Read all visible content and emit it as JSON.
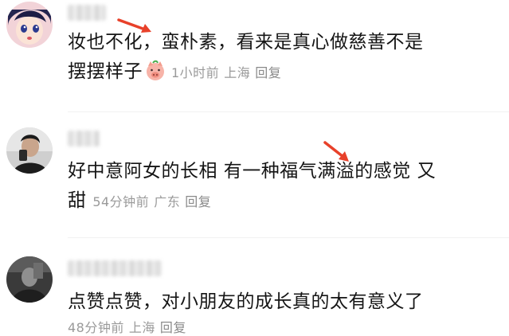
{
  "comments": [
    {
      "text_line1": "妆也不化，蛮朴素，看来是真心做慈善不是",
      "text_line2": "摆摆样子",
      "time": "1小时前",
      "location": "上海",
      "reply": "回复",
      "emoji": "pig-face-emoji"
    },
    {
      "text_line1": "好中意阿女的长相 有一种福气满溢的感觉 又",
      "text_line2": "甜",
      "time": "54分钟前",
      "location": "广东",
      "reply": "回复"
    },
    {
      "text_line1": "点赞点赞，对小朋友的成长真的太有意义了",
      "time": "48分钟前",
      "location": "上海",
      "reply": "回复"
    }
  ],
  "colors": {
    "text": "#151515",
    "meta": "#9a9a9a",
    "arrow": "#e8412a"
  }
}
